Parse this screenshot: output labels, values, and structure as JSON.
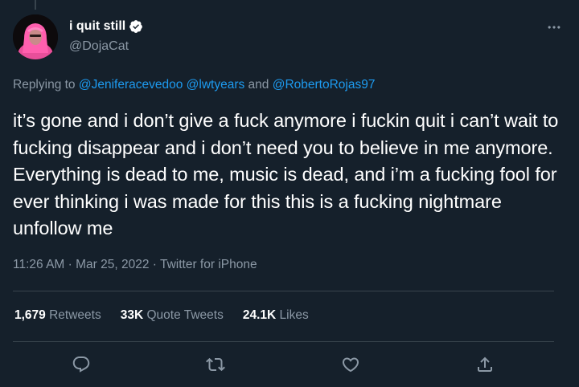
{
  "tweet": {
    "display_name": "i quit still",
    "handle": "@DojaCat",
    "verified_icon": "verified-badge-icon",
    "replying_prefix": "Replying to ",
    "replying_users": [
      "@Jeniferacevedoo",
      "@lwtyears"
    ],
    "replying_and": " and ",
    "replying_last": "@RobertoRojas97",
    "text": "it’s gone and i don’t give a fuck anymore i fuckin quit i can’t wait to fucking disappear and i don’t need you to believe in me anymore. Everything is dead to me, music is dead, and i’m a fucking fool for ever thinking i was made for this this is a fucking nightmare unfollow me",
    "time": "11:26 AM",
    "separator": " · ",
    "date": "Mar 25, 2022",
    "source": "Twitter for iPhone"
  },
  "stats": {
    "retweets_count": "1,679",
    "retweets_label": "Retweets",
    "quotes_count": "33K",
    "quotes_label": "Quote Tweets",
    "likes_count": "24.1K",
    "likes_label": "Likes"
  },
  "icons": {
    "more": "more-horizontal-icon",
    "reply": "reply-icon",
    "retweet": "retweet-icon",
    "like": "heart-icon",
    "share": "share-icon"
  },
  "colors": {
    "background": "#15202b",
    "link": "#1d9bf0",
    "secondary_text": "#8b98a5",
    "divider": "#38444d",
    "text": "#ffffff"
  }
}
